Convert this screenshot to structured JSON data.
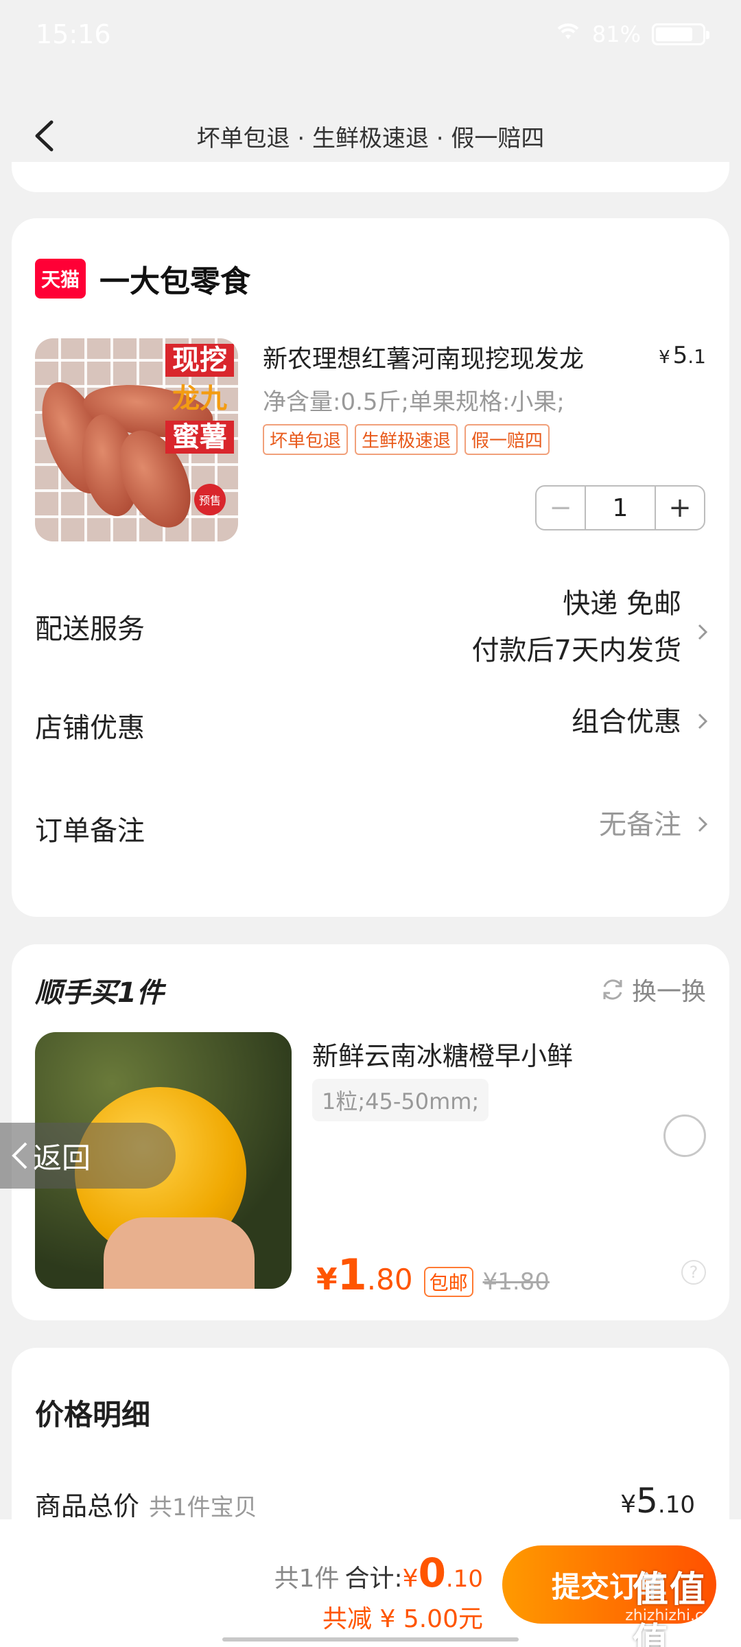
{
  "status_bar": {
    "time": "15:16",
    "battery": "81%",
    "battery_level": 0.81
  },
  "nav": {
    "title": "坏单包退 · 生鲜极速退 · 假一赔四"
  },
  "shop": {
    "logo_text": "天猫",
    "name": "一大包零食",
    "product": {
      "title": "新农理想红薯河南现挖现发龙",
      "price_currency": "¥",
      "price_int": "5",
      "price_dec": ".1",
      "spec": "净含量:0.5斤;单果规格:小果;",
      "tags": [
        "坏单包退",
        "生鲜极速退",
        "假一赔四"
      ],
      "image_text": {
        "line1": "现挖",
        "line2": "龙九",
        "line3": "蜜薯",
        "badge": "预售"
      },
      "quantity": "1"
    },
    "rows": {
      "delivery_label": "配送服务",
      "delivery_line1": "快递 免邮",
      "delivery_line2": "付款后7天内发货",
      "discount_label": "店铺优惠",
      "discount_value": "组合优惠",
      "note_label": "订单备注",
      "note_value": "无备注"
    }
  },
  "addon": {
    "title": "顺手买1件",
    "swap_label": "换一换",
    "name": "新鲜云南冰糖橙早小鲜",
    "spec": "1粒;45-50mm;",
    "price_currency": "¥",
    "price_int": "1",
    "price_dec": ".80",
    "free_shipping": "包邮",
    "original_price": "¥1.80"
  },
  "float_return": {
    "label": "返回"
  },
  "price_detail": {
    "title": "价格明细",
    "row_label": "商品总价",
    "row_sub": "共1件宝贝",
    "row_currency": "¥",
    "row_int": "5",
    "row_dec": ".10"
  },
  "bottom_bar": {
    "count": "共1件",
    "total_label": "合计:",
    "total_currency": "¥",
    "total_int": "0",
    "total_dec": ".10",
    "saved": "共减 ¥ 5.00元",
    "submit_label": "提交订单"
  },
  "watermark": {
    "logo": "值值值",
    "site": "zhizhizhi.com"
  },
  "colors": {
    "accent": "#ff5500",
    "tmall_red": "#ff0036"
  }
}
